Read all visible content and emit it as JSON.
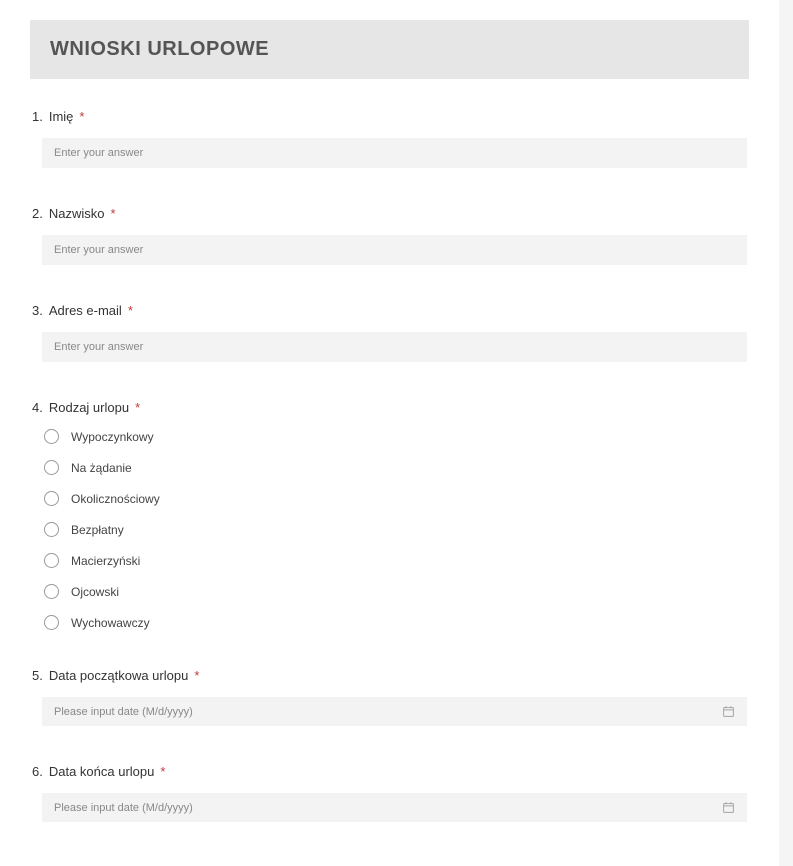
{
  "form": {
    "title": "WNIOSKI URLOPOWE",
    "text_placeholder": "Enter your answer",
    "date_placeholder": "Please input date (M/d/yyyy)",
    "required_mark": "*",
    "questions": {
      "q1": {
        "num": "1.",
        "label": "Imię"
      },
      "q2": {
        "num": "2.",
        "label": "Nazwisko"
      },
      "q3": {
        "num": "3.",
        "label": "Adres e-mail"
      },
      "q4": {
        "num": "4.",
        "label": "Rodzaj urlopu",
        "options": {
          "o1": "Wypoczynkowy",
          "o2": "Na żądanie",
          "o3": "Okolicznościowy",
          "o4": "Bezpłatny",
          "o5": "Macierzyński",
          "o6": "Ojcowski",
          "o7": "Wychowawczy"
        }
      },
      "q5": {
        "num": "5.",
        "label": "Data początkowa urlopu"
      },
      "q6": {
        "num": "6.",
        "label": "Data końca urlopu"
      }
    }
  }
}
